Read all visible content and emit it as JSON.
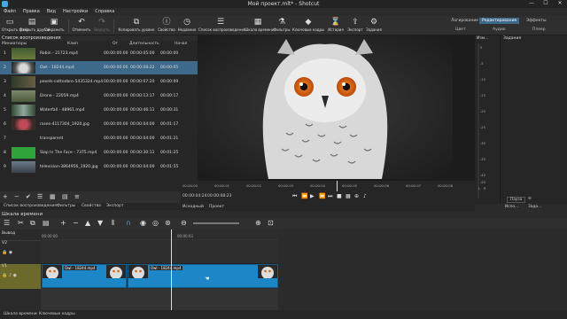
{
  "window": {
    "title": "Мой проект.mlt* - Shotcut",
    "minimize": "—",
    "maximize": "☐",
    "close": "✕"
  },
  "menu": [
    "Файл",
    "Правка",
    "Вид",
    "Настройки",
    "Справка"
  ],
  "toolbar": [
    {
      "label": "Открыть файл",
      "icon": "folder-icon"
    },
    {
      "label": "Открыть другой",
      "icon": "folder-plus-icon"
    },
    {
      "label": "Сохранить",
      "icon": "save-icon"
    },
    {
      "label": "Отменить",
      "icon": "undo-icon"
    },
    {
      "label": "Вернуть",
      "icon": "redo-icon"
    },
    {
      "label": "Копировать уровне",
      "icon": "copy-icon"
    },
    {
      "label": "Свойства",
      "icon": "info-icon"
    },
    {
      "label": "Недавние",
      "icon": "clock-icon"
    },
    {
      "label": "Список воспроизведения",
      "icon": "list-icon"
    },
    {
      "label": "Шкала времени",
      "icon": "timeline-icon"
    },
    {
      "label": "Фильтры",
      "icon": "filter-icon"
    },
    {
      "label": "Ключевые кадры",
      "icon": "keyframes-icon"
    },
    {
      "label": "История",
      "icon": "history-icon"
    },
    {
      "label": "Экспорт",
      "icon": "export-icon"
    },
    {
      "label": "Задания",
      "icon": "jobs-icon"
    }
  ],
  "layouts": {
    "logging": "Логирование",
    "editing": "Редактирование",
    "fx": "Эффекты",
    "color": "Цвет",
    "audio": "Аудио",
    "player": "Плеер"
  },
  "playlist": {
    "title": "Список воспроизведения",
    "columns": {
      "thumbs": "Миниатюры",
      "clip": "Клип",
      "in": "От",
      "duration": "Длительность",
      "start": "Начал"
    },
    "rows": [
      {
        "n": "1",
        "clip": "Robin - 21723.mp4",
        "in": "00:00:00:00",
        "dur": "00:00:05:00",
        "start": "00:00:00"
      },
      {
        "n": "2",
        "clip": "Owl - 18244.mp4",
        "in": "00:00:00:00",
        "dur": "00:00:08:22",
        "start": "00:00:05"
      },
      {
        "n": "3",
        "clip": "pexels-cottonbro-5435324.mp4",
        "in": "00:00:00:00",
        "dur": "00:00:07:20",
        "start": "00:00:09"
      },
      {
        "n": "4",
        "clip": "Drone - 22059.mp4",
        "in": "00:00:00:00",
        "dur": "00:00:13:17",
        "start": "00:00:17"
      },
      {
        "n": "5",
        "clip": "Waterfall - 48961.mp4",
        "in": "00:00:00:00",
        "dur": "00:00:46:11",
        "start": "00:00:31"
      },
      {
        "n": "6",
        "clip": "roses-4117304_1920.jpg",
        "in": "00:00:00:00",
        "dur": "00:00:04:00",
        "start": "00:01:17"
      },
      {
        "n": "7",
        "clip": "transparent",
        "in": "00:00:00:00",
        "dur": "00:00:04:00",
        "start": "00:01:21"
      },
      {
        "n": "8",
        "clip": "Slap In The Face - 7375.mp4",
        "in": "00:00:00:00",
        "dur": "00:00:30:11",
        "start": "00:01:25"
      },
      {
        "n": "9",
        "clip": "television-3864956_1920.jpg",
        "in": "00:00:00:00",
        "dur": "00:00:04:00",
        "start": "00:01:55"
      }
    ],
    "tabs": [
      "Список воспроизведения",
      "Фильтры",
      "Свойства",
      "Экспорт"
    ]
  },
  "player": {
    "ruler": [
      "00:00:00",
      "00:00:01",
      "00:00:02",
      "00:00:03",
      "00:00:04",
      "00:00:05",
      "00:00:06",
      "00:00:07",
      "00:00:08"
    ],
    "position": "00:00:04:24",
    "duration": "00:00:08:23",
    "tabs": [
      "Исходный",
      "Проект"
    ]
  },
  "meter": {
    "label": "Изм...",
    "scale": [
      "0",
      "-5",
      "-10",
      "-15",
      "-20",
      "-25",
      "-30",
      "-35",
      "-40",
      "-50",
      "L",
      "R"
    ]
  },
  "jobs": {
    "label": "Задания",
    "pause": "Пауза",
    "more": "Испо...",
    "tasks": "Зада..."
  },
  "timeline": {
    "title": "Шкала времени",
    "ruler": [
      "00:00:00",
      "00:00:03"
    ],
    "tracks": [
      {
        "name": "Вывод"
      },
      {
        "name": "V2"
      },
      {
        "name": "V1"
      }
    ],
    "clips": [
      {
        "label": "Owl - 18244.mp4"
      },
      {
        "label": "Owl - 18244.mp4"
      }
    ]
  },
  "bottom_tabs": [
    "Шкала времени",
    "Ключевые кадры"
  ]
}
